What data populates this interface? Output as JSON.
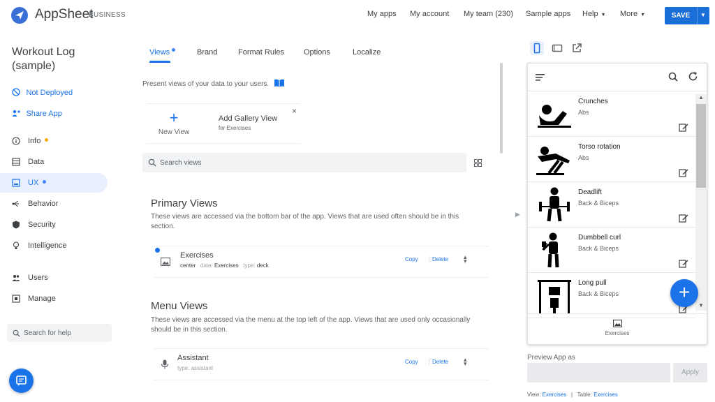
{
  "header": {
    "logo_name": "AppSheet",
    "logo_sub": "BUSINESS",
    "nav": [
      "My apps",
      "My account",
      "My team (230)",
      "Sample apps",
      "Help",
      "More"
    ],
    "save_label": "SAVE"
  },
  "sidebar": {
    "app_title": "Workout Log (sample)",
    "deploy_status": "Not Deployed",
    "share_label": "Share App",
    "items": [
      {
        "label": "Info",
        "icon": "info-icon"
      },
      {
        "label": "Data",
        "icon": "data-icon"
      },
      {
        "label": "UX",
        "icon": "ux-icon"
      },
      {
        "label": "Behavior",
        "icon": "behavior-icon"
      },
      {
        "label": "Security",
        "icon": "security-icon"
      },
      {
        "label": "Intelligence",
        "icon": "intelligence-icon"
      },
      {
        "label": "Users",
        "icon": "users-icon"
      },
      {
        "label": "Manage",
        "icon": "manage-icon"
      }
    ],
    "help_placeholder": "Search for help"
  },
  "tabs": [
    "Views",
    "Brand",
    "Format Rules",
    "Options",
    "Localize"
  ],
  "center": {
    "description": "Present views of your data to your users.",
    "new_view_label": "New View",
    "add_gallery_title": "Add Gallery View",
    "add_gallery_sub": "for Exercises",
    "search_placeholder": "Search views",
    "primary": {
      "title": "Primary Views",
      "desc": "These views are accessed via the bottom bar of the app. Views that are used often should be in this section.",
      "row": {
        "name": "Exercises",
        "position": "center",
        "data_key": "data:",
        "data_val": "Exercises",
        "type_key": "type:",
        "type_val": "deck"
      }
    },
    "menu": {
      "title": "Menu Views",
      "desc": "These views are accessed via the menu at the top left of the app. Views that are used only occasionally should be in this section.",
      "row": {
        "name": "Assistant",
        "type_key": "type:",
        "type_val": "assistant"
      }
    },
    "copy_label": "Copy",
    "delete_label": "Delete"
  },
  "preview": {
    "exercises": [
      {
        "name": "Crunches",
        "category": "Abs"
      },
      {
        "name": "Torso rotation",
        "category": "Abs"
      },
      {
        "name": "Deadlift",
        "category": "Back & Biceps"
      },
      {
        "name": "Dumbbell curl",
        "category": "Back & Biceps"
      },
      {
        "name": "Long pull",
        "category": "Back & Biceps"
      }
    ],
    "bottom_tab": "Exercises",
    "preview_as_label": "Preview App as",
    "apply_label": "Apply",
    "footer_view_label": "View:",
    "footer_view_val": "Exercises",
    "footer_sep": "|",
    "footer_table_label": "Table:",
    "footer_table_val": "Exercises"
  },
  "colors": {
    "accent": "#1a73e8",
    "dot_warning": "#f9ab00",
    "dot_info": "#4285f4"
  }
}
